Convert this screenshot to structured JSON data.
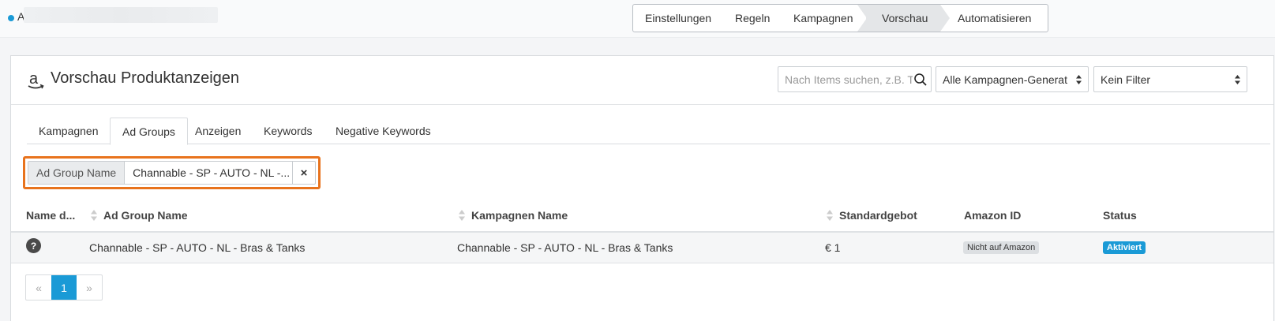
{
  "account": {
    "name": "A"
  },
  "wizard": {
    "steps": [
      "Einstellungen",
      "Regeln",
      "Kampagnen",
      "Vorschau",
      "Automatisieren"
    ],
    "active": "Vorschau"
  },
  "panel": {
    "title": "Vorschau Produktanzeigen",
    "search_placeholder": "Nach Items suchen, z.B. T",
    "generator_select": "Alle Kampagnen-Generat",
    "filter_select": "Kein Filter"
  },
  "tabs": [
    "Kampagnen",
    "Ad Groups",
    "Anzeigen",
    "Keywords",
    "Negative Keywords"
  ],
  "active_tab": "Ad Groups",
  "filter": {
    "key": "Ad Group Name",
    "value": "Channable - SP - AUTO - NL -...",
    "remove": "×"
  },
  "table": {
    "headers": [
      "Name d...",
      "Ad Group Name",
      "Kampagnen Name",
      "Standardgebot",
      "Amazon ID",
      "Status"
    ],
    "rows": [
      {
        "help": "?",
        "ad_group_name": "Channable - SP - AUTO - NL - Bras & Tanks",
        "campaign_name": "Channable - SP - AUTO - NL - Bras & Tanks",
        "standard_bid": "€ 1",
        "amazon_id": "Nicht auf Amazon",
        "status": "Aktiviert"
      }
    ]
  },
  "pagination": {
    "prev": "«",
    "current": "1",
    "next": "»"
  },
  "colors": {
    "accent": "#1a9ad6",
    "highlight": "#e8731d"
  }
}
